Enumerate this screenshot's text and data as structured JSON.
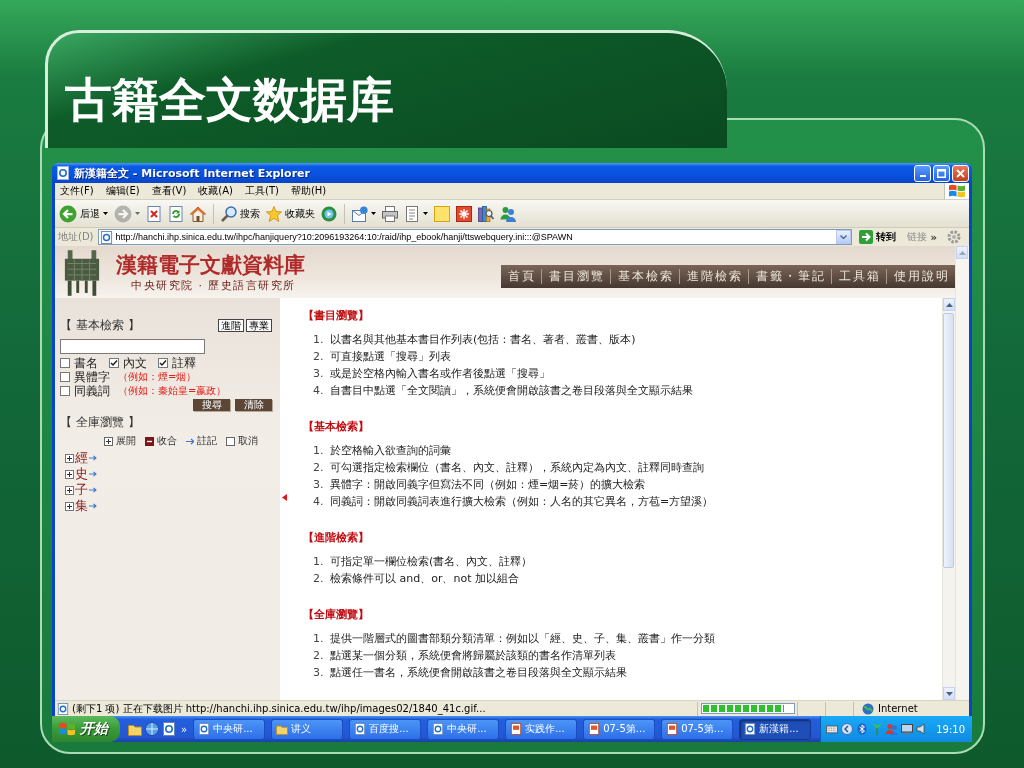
{
  "slide": {
    "title": "古籍全文数据库"
  },
  "browser": {
    "title": "新漢籍全文 - Microsoft Internet Explorer",
    "menu": [
      "文件(F)",
      "编辑(E)",
      "查看(V)",
      "收藏(A)",
      "工具(T)",
      "帮助(H)"
    ],
    "toolbar": [
      {
        "kind": "back",
        "label": "后退",
        "dropdown": true,
        "disabled": false
      },
      {
        "kind": "forward",
        "dropdown": true,
        "disabled": true
      },
      {
        "kind": "stop",
        "dropdown": false,
        "disabled": false
      },
      {
        "kind": "refresh",
        "dropdown": false,
        "disabled": false
      },
      {
        "kind": "home",
        "dropdown": false,
        "disabled": false
      },
      {
        "kind": "separator"
      },
      {
        "kind": "search",
        "label": "搜索",
        "dropdown": false,
        "disabled": false
      },
      {
        "kind": "favorites",
        "label": "收藏夹",
        "dropdown": false,
        "disabled": false
      },
      {
        "kind": "media",
        "dropdown": false,
        "disabled": false
      },
      {
        "kind": "separator"
      },
      {
        "kind": "mail",
        "dropdown": true,
        "disabled": false
      },
      {
        "kind": "print",
        "dropdown": false,
        "disabled": false
      },
      {
        "kind": "edit",
        "dropdown": true,
        "disabled": false
      },
      {
        "kind": "note",
        "dropdown": false,
        "disabled": false
      },
      {
        "kind": "tool",
        "dropdown": false,
        "disabled": false
      },
      {
        "kind": "research",
        "dropdown": false,
        "disabled": false
      },
      {
        "kind": "messenger",
        "dropdown": false,
        "disabled": false
      }
    ],
    "address": {
      "label": "地址(D)",
      "value": "http://hanchi.ihp.sinica.edu.tw/ihpc/hanjiquery?10:2096193264:10:/raid/ihp_ebook/hanji/ttswebquery.ini:::@SPAWN",
      "go": "转到",
      "links": "链接",
      "more": "»"
    }
  },
  "page": {
    "site_title": "漢籍電子文獻資料庫",
    "site_subtitle": "中央研究院 · 歷史語言研究所",
    "nav": [
      "首頁",
      "書目瀏覽",
      "基本檢索",
      "進階檢索",
      "書籤・筆記",
      "工具箱",
      "使用說明"
    ],
    "basic_search": {
      "heading": "【 基本檢索 】",
      "modes": [
        "進階",
        "專業"
      ],
      "fields": [
        {
          "label": "書名",
          "checked": false
        },
        {
          "label": "內文",
          "checked": true
        },
        {
          "label": "註釋",
          "checked": true
        }
      ],
      "expansions": [
        {
          "label": "異體字",
          "example": "（例如：煙=烟）",
          "checked": false
        },
        {
          "label": "同義詞",
          "example": "（例如：秦始皇=嬴政）",
          "checked": false
        }
      ],
      "buttons": [
        "搜尋",
        "清除"
      ]
    },
    "browse": {
      "heading": "【 全庫瀏覽 】",
      "controls": [
        {
          "kind": "expand",
          "label": "展開"
        },
        {
          "kind": "collapse",
          "label": "收合"
        },
        {
          "kind": "note",
          "label": "註記"
        },
        {
          "kind": "cancel",
          "label": "取消"
        }
      ],
      "tree": [
        {
          "label": "經",
          "expanded": false
        },
        {
          "label": "史",
          "expanded": false
        },
        {
          "label": "子",
          "expanded": false
        },
        {
          "label": "集",
          "expanded": false
        }
      ]
    },
    "sections": [
      {
        "heading": "【書目瀏覽】",
        "items": [
          {
            "number": "1.",
            "text": "以書名與其他基本書目作列表(包括：書名、著者、叢書、版本)"
          },
          {
            "number": "2.",
            "text": "可直接點選「搜尋」列表"
          },
          {
            "number": "3.",
            "text": "或是於空格內輸入書名或作者後點選「搜尋」"
          },
          {
            "number": "4.",
            "text": "自書目中點選「全文閱讀」，系統便會開啟該書之卷目段落與全文顯示結果"
          }
        ]
      },
      {
        "heading": "【基本檢索】",
        "items": [
          {
            "number": "1.",
            "text": "於空格輸入欲查詢的詞彙"
          },
          {
            "number": "2.",
            "text": "可勾選指定檢索欄位（書名、內文、註釋），系統內定為內文、註釋同時查詢"
          },
          {
            "number": "3.",
            "text": "異體字：開啟同義字但寫法不同（例如：煙=烟=菸）的擴大檢索"
          },
          {
            "number": "4.",
            "text": "同義詞：開啟同義詞表進行擴大檢索（例如：人名的其它異名，方苞=方望溪）"
          }
        ]
      },
      {
        "heading": "【進階檢索】",
        "items": [
          {
            "number": "1.",
            "text": "可指定單一欄位檢索(書名、內文、註釋）"
          },
          {
            "number": "2.",
            "text": "檢索條件可以 and、or、not 加以組合"
          }
        ]
      },
      {
        "heading": "【全庫瀏覽】",
        "items": [
          {
            "number": "1.",
            "text": "提供一階層式的圖書部類分類清單：例如以「經、史、子、集、叢書」作一分類"
          },
          {
            "number": "2.",
            "text": "點選某一個分類，系統便會將歸屬於該類的書名作清單列表"
          },
          {
            "number": "3.",
            "text": "點選任一書名，系統便會開啟該書之卷目段落與全文顯示結果"
          }
        ]
      }
    ]
  },
  "status_bar": {
    "text": "(剩下1 项) 正在下载图片 http://hanchi.ihp.sinica.edu.tw/ihp/images02/1840_41c.gif...",
    "progress": {
      "level": 0.9
    },
    "zone": "Internet"
  },
  "taskbar": {
    "start": "开始",
    "more": "»",
    "tasks": [
      {
        "kind": "browser",
        "label": "中央研...",
        "selected": false
      },
      {
        "kind": "folder",
        "label": "讲义",
        "selected": false
      },
      {
        "kind": "browser",
        "label": "百度搜...",
        "selected": false
      },
      {
        "kind": "browser",
        "label": "中央研...",
        "selected": false
      },
      {
        "kind": "slides",
        "label": "实践作...",
        "selected": false
      },
      {
        "kind": "slides",
        "label": "07-5第...",
        "selected": false
      },
      {
        "kind": "slides",
        "label": "07-5第...",
        "selected": false
      },
      {
        "kind": "browser",
        "label": "新漢籍...",
        "selected": true
      }
    ],
    "clock": "19:10"
  }
}
